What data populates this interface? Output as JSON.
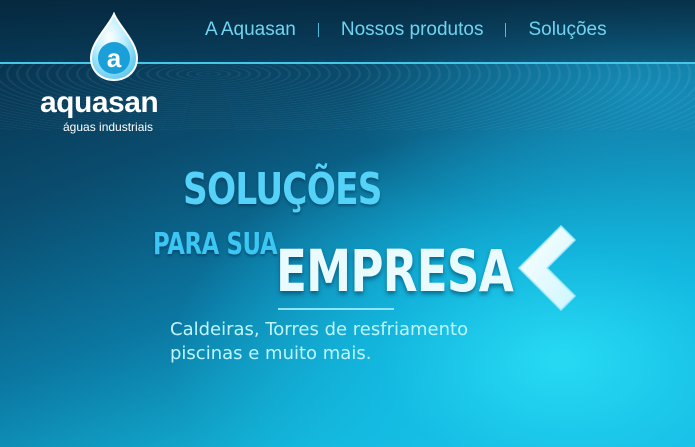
{
  "header": {
    "logo": {
      "mark_letter": "a",
      "name": "aquasan",
      "tagline": "águas industriais"
    },
    "nav": [
      {
        "label": "A Aquasan"
      },
      {
        "label": "Nossos produtos"
      },
      {
        "label": "Soluções"
      }
    ]
  },
  "hero": {
    "line1": "SOLUÇÕES",
    "line2": "PARA SUA",
    "line3": "EMPRESA",
    "subtitle_line1": "Caldeiras, Torres de resfriamento",
    "subtitle_line2": "piscinas e muito mais.",
    "prev_icon": "chevron-left-icon"
  },
  "colors": {
    "nav_text": "#6fd4f0",
    "hero_cyan": "#55d2f7",
    "hero_light": "#e9fbff",
    "accent_line": "#46c7e8"
  }
}
